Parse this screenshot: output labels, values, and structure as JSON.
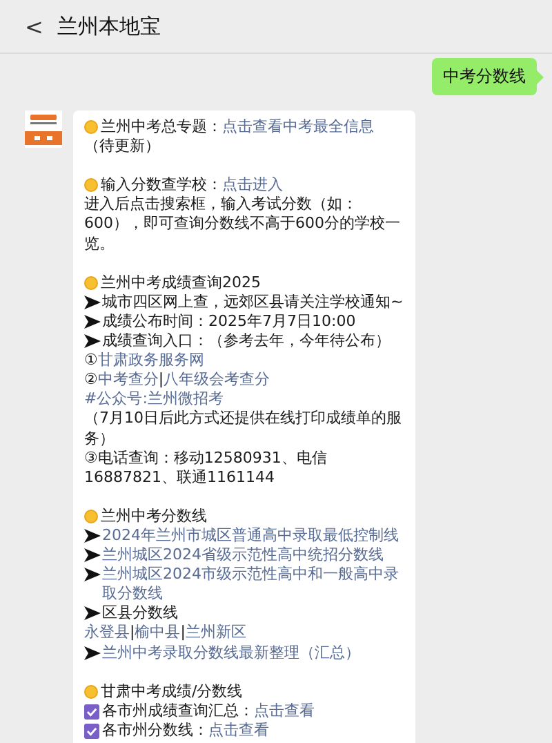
{
  "header": {
    "back": "<",
    "title": "兰州本地宝"
  },
  "outgoing": {
    "text": "中考分数线"
  },
  "message": {
    "sections": [
      {
        "lines": [
          {
            "kind": "heading",
            "parts": [
              {
                "text": "兰州中考总专题：",
                "link": false
              },
              {
                "text": "点击查看中考最全信息",
                "link": true
              }
            ]
          },
          {
            "kind": "plain",
            "parts": [
              {
                "text": "（待更新）",
                "link": false
              }
            ]
          }
        ]
      },
      {
        "lines": [
          {
            "kind": "heading",
            "parts": [
              {
                "text": "输入分数查学校：",
                "link": false
              },
              {
                "text": "点击进入",
                "link": true
              }
            ]
          },
          {
            "kind": "plain",
            "parts": [
              {
                "text": "进入后点击搜索框，输入考试分数（如：600），即可查询分数线不高于600分的学校一览。",
                "link": false
              }
            ]
          }
        ]
      },
      {
        "lines": [
          {
            "kind": "heading",
            "parts": [
              {
                "text": "兰州中考成绩查询2025",
                "link": false
              }
            ]
          },
          {
            "kind": "arrow",
            "parts": [
              {
                "text": "城市四区网上查，远郊区县请关注学校通知~",
                "link": false
              }
            ]
          },
          {
            "kind": "arrow",
            "parts": [
              {
                "text": "成绩公布时间：2025年7月7日10:00",
                "link": false
              }
            ]
          },
          {
            "kind": "arrow",
            "parts": [
              {
                "text": "成绩查询入口：（参考去年，今年待公布）",
                "link": false
              }
            ]
          },
          {
            "kind": "plain",
            "parts": [
              {
                "text": "①",
                "link": false
              },
              {
                "text": "甘肃政务服务网",
                "link": true
              }
            ]
          },
          {
            "kind": "plain",
            "parts": [
              {
                "text": "②",
                "link": false
              },
              {
                "text": "中考查分",
                "link": true
              },
              {
                "text": "|",
                "link": false
              },
              {
                "text": "八年级会考查分",
                "link": true
              }
            ]
          },
          {
            "kind": "plain",
            "parts": [
              {
                "text": "#公众号:兰州微招考",
                "link": true
              }
            ]
          },
          {
            "kind": "plain",
            "parts": [
              {
                "text": "（7月10日后此方式还提供在线打印成绩单的服务）",
                "link": false
              }
            ]
          },
          {
            "kind": "plain",
            "parts": [
              {
                "text": "③电话查询：移动12580931、电信16887821、联通1161144",
                "link": false
              }
            ]
          }
        ]
      },
      {
        "lines": [
          {
            "kind": "heading",
            "parts": [
              {
                "text": "兰州中考分数线",
                "link": false
              }
            ]
          },
          {
            "kind": "arrow",
            "parts": [
              {
                "text": "2024年兰州市城区普通高中录取最低控制线",
                "link": true
              }
            ]
          },
          {
            "kind": "arrow",
            "parts": [
              {
                "text": "兰州城区2024省级示范性高中统招分数线",
                "link": true
              }
            ]
          },
          {
            "kind": "arrow",
            "parts": [
              {
                "text": "兰州城区2024市级示范性高中和一般高中录取分数线",
                "link": true
              }
            ]
          },
          {
            "kind": "arrow",
            "parts": [
              {
                "text": "区县分数线",
                "link": false
              }
            ]
          },
          {
            "kind": "plain",
            "parts": [
              {
                "text": "永登县",
                "link": true
              },
              {
                "text": "|",
                "link": false
              },
              {
                "text": "榆中县",
                "link": true
              },
              {
                "text": "|",
                "link": false
              },
              {
                "text": "兰州新区",
                "link": true
              }
            ]
          },
          {
            "kind": "arrow",
            "parts": [
              {
                "text": "兰州中考录取分数线最新整理（汇总）",
                "link": true
              }
            ]
          }
        ]
      },
      {
        "lines": [
          {
            "kind": "heading",
            "parts": [
              {
                "text": "甘肃中考成绩/分数线",
                "link": false
              }
            ]
          },
          {
            "kind": "check",
            "parts": [
              {
                "text": "各市州成绩查询汇总：",
                "link": false
              },
              {
                "text": "点击查看",
                "link": true
              }
            ]
          },
          {
            "kind": "check",
            "parts": [
              {
                "text": "各市州分数线：",
                "link": false
              },
              {
                "text": "点击查看",
                "link": true
              }
            ]
          }
        ]
      }
    ]
  }
}
